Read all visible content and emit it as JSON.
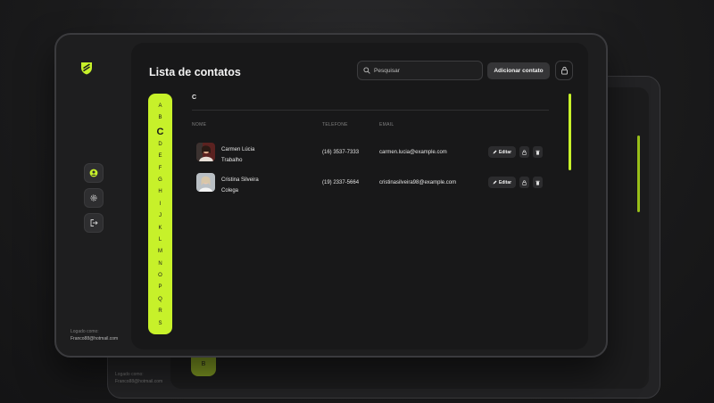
{
  "app": {
    "title": "Lista de contatos",
    "accent": "#c7f12a"
  },
  "search": {
    "placeholder": "Pesquisar",
    "value": ""
  },
  "toolbar": {
    "add_label": "Adicionar contato"
  },
  "sidebar": {
    "logo": "shield-logo",
    "items": [
      {
        "icon": "user-circle-icon"
      },
      {
        "icon": "gear-icon"
      },
      {
        "icon": "logout-icon"
      }
    ],
    "logged_label": "Logado como:",
    "logged_email": "Franco88@hotmail.com"
  },
  "alphabet": {
    "letters": [
      "A",
      "B",
      "C",
      "D",
      "E",
      "F",
      "G",
      "H",
      "I",
      "J",
      "K",
      "L",
      "M",
      "N",
      "O",
      "P",
      "Q",
      "R",
      "S"
    ],
    "active": "C"
  },
  "section": {
    "letter": "C"
  },
  "columns": {
    "name": "NOME",
    "phone": "TELEFONE",
    "email": "EMAIL"
  },
  "contacts": [
    {
      "name": "Carmen Lúcia",
      "group": "Trabalho",
      "phone": "(16) 3537-7333",
      "email": "carmen.lucia@example.com",
      "edit_label": "Editar"
    },
    {
      "name": "Cristina Silveira",
      "group": "Colega",
      "phone": "(19) 2337-5664",
      "email": "cristinasilveira98@example.com",
      "edit_label": "Editar"
    }
  ],
  "background_device": {
    "alpha_letter": "B",
    "logged_label": "Logado como:",
    "logged_email": "Franco88@hotmail.com"
  }
}
